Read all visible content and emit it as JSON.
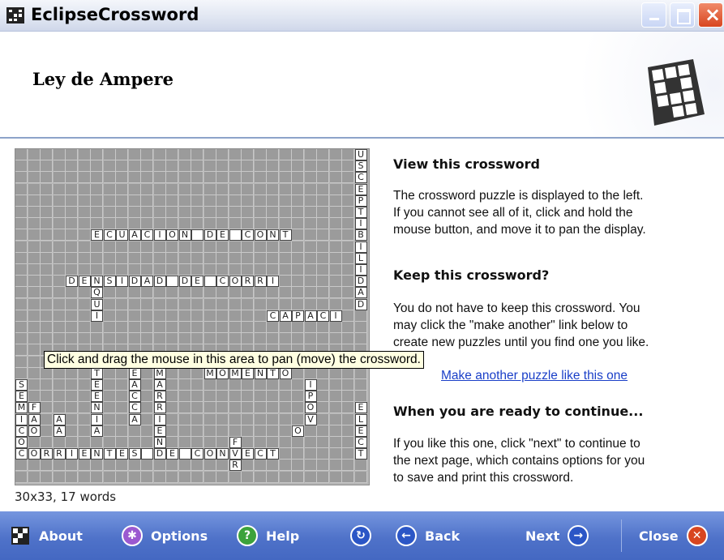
{
  "window": {
    "title": "EclipseCrossword"
  },
  "header": {
    "page_title": "Ley de Ampere"
  },
  "grid": {
    "rows": 29,
    "cols": 28,
    "words": [
      {
        "r": 0,
        "c": 27,
        "dir": "down",
        "text": "USCEPTIBILIDAD"
      },
      {
        "r": 7,
        "c": 6,
        "dir": "across",
        "text": "ECUACION DE CONT"
      },
      {
        "r": 11,
        "c": 4,
        "dir": "across",
        "text": "DENSIDAD DE CORRI"
      },
      {
        "r": 12,
        "c": 6,
        "dir": "down",
        "text": "QUI"
      },
      {
        "r": 14,
        "c": 20,
        "dir": "across",
        "text": "CAPACI"
      },
      {
        "r": 18,
        "c": 6,
        "dir": "down",
        "text": "OTEENIA"
      },
      {
        "r": 18,
        "c": 9,
        "dir": "down",
        "text": "LEACCA"
      },
      {
        "r": 18,
        "c": 11,
        "dir": "down",
        "text": "CMARRIEN"
      },
      {
        "r": 19,
        "c": 15,
        "dir": "across",
        "text": "MOMENTO"
      },
      {
        "r": 20,
        "c": 0,
        "dir": "down",
        "text": "SEMICO"
      },
      {
        "r": 20,
        "c": 23,
        "dir": "down",
        "text": "IPOV"
      },
      {
        "r": 22,
        "c": 1,
        "dir": "down",
        "text": "FAO"
      },
      {
        "r": 22,
        "c": 27,
        "dir": "down",
        "text": "ELECT"
      },
      {
        "r": 23,
        "c": 3,
        "dir": "down",
        "text": "AA"
      },
      {
        "r": 25,
        "c": 17,
        "dir": "down",
        "text": "FER"
      },
      {
        "r": 26,
        "c": 0,
        "dir": "across",
        "text": "CORRIENTES DE CONVECT"
      },
      {
        "r": 24,
        "c": 22,
        "dir": "across",
        "text": "O"
      }
    ]
  },
  "tooltip": "Click and drag the mouse in this area to pan (move) the crossword.",
  "status_text": "30x33, 17 words",
  "right_panel": {
    "view_heading": "View this crossword",
    "view_text_1": "The crossword puzzle is displayed to the left.",
    "view_text_2": "If you cannot see all of it, click and hold the",
    "view_text_3": "mouse button, and move it to pan the display.",
    "keep_heading": "Keep this crossword?",
    "keep_text_1": "You do not have to keep this crossword.  You",
    "keep_text_2": "may click the \"make another\" link below to",
    "keep_text_3": "create new puzzles until you find one you like.",
    "make_another_link": "Make another puzzle like this one",
    "ready_heading": "When you are ready to continue...",
    "ready_text_1": "If you like this one, click \"next\" to continue to",
    "ready_text_2": "the next page, which contains options for you",
    "ready_text_3": "to save and print this crossword."
  },
  "bottom_bar": {
    "about": "About",
    "options": "Options",
    "help": "Help",
    "back": "Back",
    "next": "Next",
    "close": "Close"
  },
  "colors": {
    "bar_blue": "#4f72c9",
    "link_blue": "#1a3fc8",
    "tooltip_bg": "#ffffe1"
  }
}
